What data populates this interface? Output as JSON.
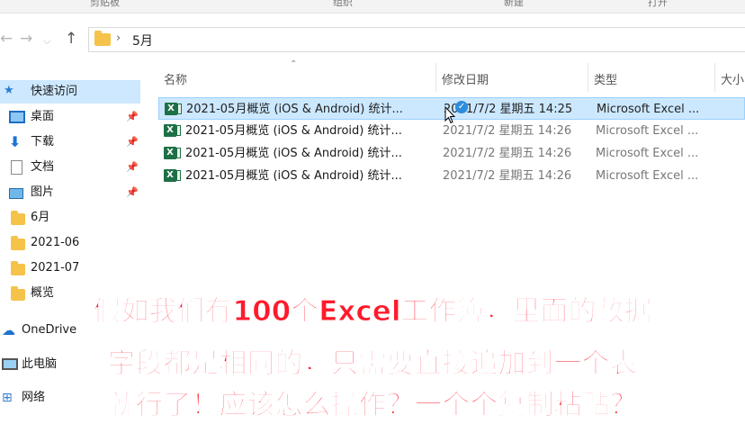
{
  "toolbar_top": [
    "剪贴板",
    "组织",
    "新建",
    "打开"
  ],
  "address": {
    "current_folder": "5月"
  },
  "sidebar": {
    "items": [
      {
        "label": "快速访问",
        "icon": "star-icon",
        "selected": true,
        "pinned": false
      },
      {
        "label": "桌面",
        "icon": "desktop-icon",
        "pinned": true
      },
      {
        "label": "下载",
        "icon": "download-icon",
        "pinned": true
      },
      {
        "label": "文档",
        "icon": "document-icon",
        "pinned": true
      },
      {
        "label": "图片",
        "icon": "pictures-icon",
        "pinned": true
      },
      {
        "label": "6月",
        "icon": "folder-icon",
        "pinned": false
      },
      {
        "label": "2021-06",
        "icon": "folder-icon",
        "pinned": false
      },
      {
        "label": "2021-07",
        "icon": "folder-icon",
        "pinned": false
      },
      {
        "label": "概览",
        "icon": "folder-icon",
        "pinned": false
      },
      {
        "label": "OneDrive",
        "icon": "onedrive-icon",
        "pinned": false
      },
      {
        "label": "此电脑",
        "icon": "this-pc-icon",
        "pinned": false
      },
      {
        "label": "网络",
        "icon": "network-icon",
        "pinned": false
      }
    ]
  },
  "columns": {
    "name": "名称",
    "date": "修改日期",
    "type": "类型",
    "size": "大小"
  },
  "files": [
    {
      "name": "2021-05月概览 (iOS & Android)  统计...",
      "date": "2021/7/2 星期五 14:25",
      "type": "Microsoft Excel ...",
      "selected": true
    },
    {
      "name": "2021-05月概览 (iOS & Android)  统计...",
      "date": "2021/7/2 星期五 14:26",
      "type": "Microsoft Excel ...",
      "selected": false
    },
    {
      "name": "2021-05月概览 (iOS & Android)  统计...",
      "date": "2021/7/2 星期五 14:26",
      "type": "Microsoft Excel ...",
      "selected": false
    },
    {
      "name": "2021-05月概览 (iOS & Android)  统计...",
      "date": "2021/7/2 星期五 14:26",
      "type": "Microsoft Excel ...",
      "selected": false
    }
  ],
  "caption": {
    "line1": "假如我们有100个Excel工作簿，里面的数据",
    "line2": "字段都是相同的，只需要直接追加到一个表",
    "line3": "就行了！应该怎么操作？一个个复制粘贴？"
  },
  "colors": {
    "selection": "#cce8ff",
    "caption": "#ff1a2b",
    "excel": "#1d7045"
  }
}
